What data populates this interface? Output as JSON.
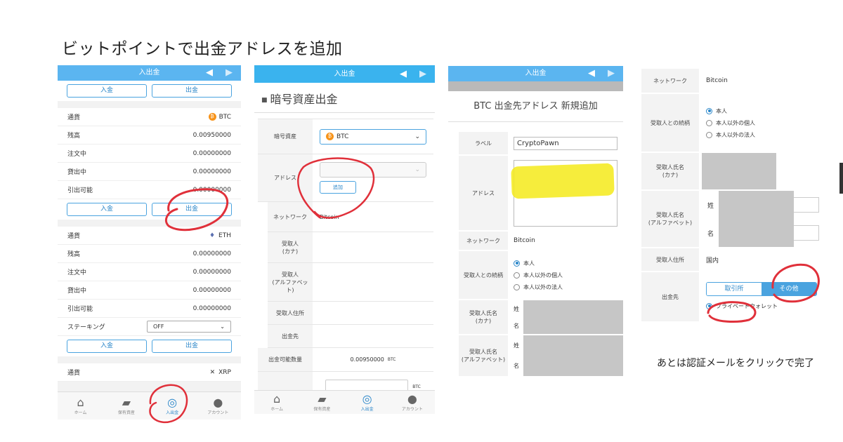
{
  "title": "ビットポイントで出金アドレスを追加",
  "nav_header": "入出金",
  "p1": {
    "deposit": "入金",
    "withdraw": "出金",
    "btc": {
      "currency_label": "通貨",
      "currency_icon": "₿",
      "currency": "BTC",
      "balance_label": "残高",
      "balance": "0.00950000",
      "ordering_label": "注文中",
      "ordering": "0.00000000",
      "lending_label": "貸出中",
      "lending": "0.00000000",
      "available_label": "引出可能",
      "available": "0.00000000"
    },
    "eth": {
      "currency_label": "通貨",
      "currency_icon": "♦",
      "currency": "ETH",
      "balance_label": "残高",
      "balance": "0.00000000",
      "ordering_label": "注文中",
      "ordering": "0.00000000",
      "lending_label": "貸出中",
      "lending": "0.00000000",
      "available_label": "引出可能",
      "available": "0.00000000",
      "staking_label": "ステーキング",
      "staking_value": "OFF"
    },
    "xrp": {
      "currency_label": "通貨",
      "currency_icon": "✕",
      "currency": "XRP"
    }
  },
  "tabs": {
    "home": "ホーム",
    "holdings": "保有資産",
    "inout": "入出金",
    "account": "アカウント"
  },
  "p2": {
    "section_title": "暗号資産出金",
    "crypto_label": "暗号資産",
    "crypto_value": "BTC",
    "address_label": "アドレス",
    "add_button": "追加",
    "network_label": "ネットワーク",
    "network_value": "Bitcoin",
    "recipient_kana_label": "受取人\n(カナ)",
    "recipient_alpha_label": "受取人\n(アルファベット)",
    "recipient_address_label": "受取人住所",
    "destination_label": "出金先",
    "withdrawable_label": "出金可能数量",
    "withdrawable_value": "0.00950000",
    "withdrawable_unit": "BTC",
    "amount_unit": "BTC"
  },
  "p3": {
    "title": "BTC 出金先アドレス 新規追加",
    "label_label": "ラベル",
    "label_value": "CryptoPawn",
    "address_label": "アドレス",
    "network_label": "ネットワーク",
    "network_value": "Bitcoin",
    "relation_label": "受取人との続柄",
    "relation_options": [
      "本人",
      "本人以外の個人",
      "本人以外の法人"
    ],
    "kana_label": "受取人氏名\n(カナ)",
    "alpha_label": "受取人氏名\n(アルファベット)",
    "surname": "姓",
    "given": "名"
  },
  "p4": {
    "network_label": "ネットワーク",
    "network_value": "Bitcoin",
    "relation_label": "受取人との続柄",
    "relation_options": [
      "本人",
      "本人以外の個人",
      "本人以外の法人"
    ],
    "kana_label": "受取人氏名\n(カナ)",
    "alpha_label": "受取人氏名\n(アルファベット)",
    "surname": "姓",
    "given": "名",
    "address_label": "受取人住所",
    "address_value": "国内",
    "destination_label": "出金先",
    "seg_exchange": "取引所",
    "seg_other": "その他",
    "private_wallet": "プライベートウォレット"
  },
  "note": "あとは認証メールをクリックで完了",
  "colors": {
    "accent": "#5bb5f0",
    "annotation_red": "#e0303a",
    "highlight": "#f4ea1a"
  }
}
